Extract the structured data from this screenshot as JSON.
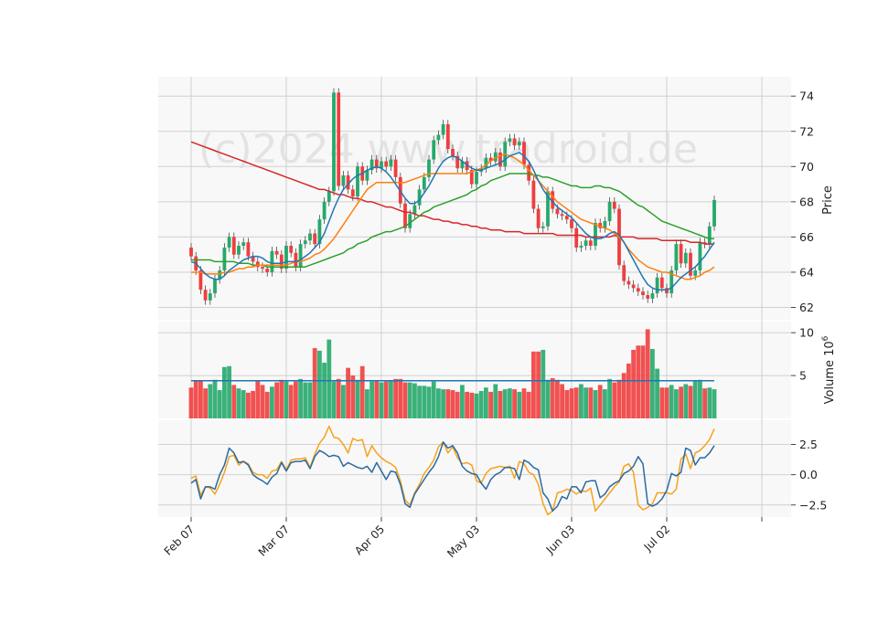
{
  "chart_data": [
    {
      "type": "candlestick",
      "panel": "price",
      "watermark": "(c)2024 www.tradroid.de",
      "ylabel": "Price",
      "ylim": [
        61.3,
        75.1
      ],
      "yticks": [
        62,
        64,
        66,
        68,
        70,
        72,
        74
      ],
      "x_tick_labels": [
        "Feb 07",
        "Mar 07",
        "Apr 05",
        "May 03",
        "Jun 03",
        "Jul 02"
      ],
      "x_tick_index": [
        0,
        20,
        40,
        60,
        80,
        100,
        120
      ],
      "grid": true,
      "colors": {
        "up": "#26a96b",
        "down": "#ef3e3e",
        "ma_fast": "#1f77b4",
        "ma_mid": "#ff7f0e",
        "ma_slow": "#2ca02c",
        "ma_long": "#d62728"
      },
      "closes": [
        64.9,
        64.1,
        63.0,
        62.4,
        62.8,
        63.6,
        64.1,
        65.4,
        66.0,
        65.0,
        65.5,
        65.7,
        64.9,
        64.6,
        64.3,
        64.2,
        64.0,
        65.2,
        65.0,
        64.2,
        65.5,
        65.1,
        64.3,
        65.6,
        65.8,
        66.2,
        65.6,
        67.0,
        68.0,
        68.6,
        74.2,
        68.9,
        69.5,
        68.7,
        68.3,
        70.0,
        69.2,
        69.8,
        70.4,
        69.9,
        70.3,
        70.0,
        70.4,
        69.4,
        67.9,
        66.5,
        67.3,
        67.8,
        68.7,
        69.4,
        70.4,
        71.5,
        71.8,
        72.4,
        71.0,
        70.6,
        69.9,
        70.3,
        69.8,
        69.0,
        69.7,
        69.9,
        70.5,
        70.3,
        70.8,
        70.0,
        71.4,
        71.6,
        71.2,
        71.4,
        70.1,
        69.2,
        67.6,
        66.5,
        66.6,
        68.6,
        67.6,
        67.3,
        67.2,
        67.0,
        66.5,
        65.4,
        65.5,
        65.8,
        65.5,
        66.8,
        66.5,
        66.9,
        68.0,
        67.6,
        64.4,
        63.5,
        63.3,
        63.1,
        62.9,
        62.7,
        62.5,
        62.8,
        63.7,
        63.1,
        62.8,
        64.1,
        65.6,
        64.5,
        65.1,
        63.8,
        64.1,
        65.7,
        65.6,
        66.6,
        68.1
      ],
      "volumes": [
        3.6,
        4.4,
        4.4,
        3.5,
        4.0,
        4.5,
        3.3,
        6.0,
        6.1,
        3.9,
        3.5,
        3.3,
        3.0,
        3.2,
        4.4,
        3.9,
        3.1,
        3.7,
        4.2,
        4.5,
        4.3,
        3.9,
        4.3,
        4.6,
        4.2,
        4.2,
        8.2,
        7.9,
        6.5,
        9.2,
        4.3,
        4.6,
        3.9,
        5.9,
        5.0,
        4.5,
        6.1,
        3.4,
        4.3,
        4.4,
        4.2,
        4.3,
        4.4,
        4.6,
        4.6,
        4.2,
        4.2,
        4.1,
        3.8,
        3.8,
        3.7,
        4.3,
        3.5,
        3.4,
        3.4,
        3.3,
        3.1,
        3.9,
        3.1,
        3.0,
        2.9,
        3.2,
        3.6,
        3.1,
        4.0,
        3.2,
        3.4,
        3.5,
        3.4,
        3.1,
        3.5,
        3.1,
        7.8,
        7.8,
        8.0,
        4.5,
        4.7,
        4.5,
        4.0,
        3.3,
        3.5,
        3.6,
        4.0,
        3.6,
        3.6,
        3.3,
        3.9,
        3.4,
        4.6,
        4.2,
        4.5,
        5.3,
        6.4,
        8.0,
        8.5,
        8.5,
        10.4,
        8.1,
        5.8,
        3.6,
        3.6,
        3.9,
        3.4,
        3.7,
        4.0,
        3.8,
        4.4,
        4.5,
        3.5,
        3.6,
        3.4
      ],
      "ma_fast": [
        64.6,
        64.5,
        64.2,
        63.9,
        63.7,
        63.6,
        63.6,
        63.8,
        64.1,
        64.3,
        64.5,
        64.7,
        64.8,
        64.9,
        64.9,
        64.8,
        64.6,
        64.5,
        64.5,
        64.5,
        64.6,
        64.6,
        64.6,
        64.7,
        64.9,
        65.1,
        65.4,
        65.7,
        66.2,
        66.9,
        67.6,
        68.2,
        68.7,
        69.0,
        69.3,
        69.5,
        69.6,
        69.8,
        69.9,
        70.0,
        69.9,
        69.7,
        69.4,
        69.0,
        68.6,
        68.2,
        67.9,
        67.9,
        68.1,
        68.5,
        68.9,
        69.4,
        69.9,
        70.3,
        70.5,
        70.6,
        70.5,
        70.3,
        70.1,
        69.9,
        69.8,
        69.8,
        69.9,
        70.0,
        70.1,
        70.2,
        70.4,
        70.6,
        70.7,
        70.8,
        70.6,
        70.3,
        69.8,
        69.2,
        68.7,
        68.3,
        68.0,
        67.7,
        67.5,
        67.3,
        67.1,
        66.8,
        66.5,
        66.2,
        66.0,
        65.9,
        65.9,
        66.0,
        66.2,
        66.3,
        66.1,
        65.7,
        65.2,
        64.7,
        64.2,
        63.7,
        63.3,
        63.1,
        63.0,
        63.0,
        63.0,
        63.1,
        63.4,
        63.7,
        63.9,
        64.1,
        64.3,
        64.6,
        64.9,
        65.3,
        65.7
      ],
      "ma_mid": [
        64.0,
        64.0,
        64.0,
        63.9,
        63.9,
        63.9,
        63.9,
        64.0,
        64.0,
        64.1,
        64.2,
        64.2,
        64.3,
        64.3,
        64.4,
        64.4,
        64.4,
        64.4,
        64.4,
        64.4,
        64.4,
        64.5,
        64.6,
        64.6,
        64.7,
        64.8,
        65.0,
        65.1,
        65.3,
        65.6,
        65.9,
        66.3,
        66.7,
        67.1,
        67.5,
        67.9,
        68.3,
        68.7,
        68.9,
        69.1,
        69.1,
        69.1,
        69.1,
        69.1,
        69.1,
        69.1,
        69.2,
        69.3,
        69.4,
        69.5,
        69.6,
        69.6,
        69.6,
        69.6,
        69.6,
        69.6,
        69.6,
        69.6,
        69.6,
        69.7,
        69.8,
        69.9,
        70.1,
        70.3,
        70.5,
        70.6,
        70.7,
        70.6,
        70.5,
        70.3,
        70.1,
        69.8,
        69.5,
        69.2,
        68.9,
        68.6,
        68.3,
        68.0,
        67.8,
        67.6,
        67.4,
        67.2,
        67.0,
        66.9,
        66.8,
        66.7,
        66.6,
        66.5,
        66.4,
        66.2,
        66.0,
        65.7,
        65.3,
        65.0,
        64.7,
        64.5,
        64.3,
        64.2,
        64.1,
        64.0,
        64.0,
        63.9,
        63.8,
        63.7,
        63.6,
        63.6,
        63.7,
        63.8,
        64.0,
        64.1,
        64.3
      ],
      "ma_slow": [
        64.7,
        64.7,
        64.7,
        64.7,
        64.7,
        64.6,
        64.6,
        64.6,
        64.6,
        64.6,
        64.5,
        64.5,
        64.5,
        64.4,
        64.4,
        64.4,
        64.3,
        64.3,
        64.3,
        64.3,
        64.3,
        64.3,
        64.3,
        64.3,
        64.3,
        64.4,
        64.5,
        64.6,
        64.7,
        64.8,
        64.9,
        65.0,
        65.1,
        65.3,
        65.4,
        65.6,
        65.7,
        65.8,
        66.0,
        66.1,
        66.2,
        66.3,
        66.3,
        66.4,
        66.5,
        66.6,
        66.8,
        67.0,
        67.2,
        67.4,
        67.5,
        67.7,
        67.8,
        67.9,
        68.0,
        68.1,
        68.2,
        68.3,
        68.4,
        68.6,
        68.7,
        68.9,
        69.0,
        69.2,
        69.3,
        69.4,
        69.5,
        69.6,
        69.6,
        69.6,
        69.6,
        69.6,
        69.5,
        69.5,
        69.4,
        69.4,
        69.3,
        69.2,
        69.1,
        69.0,
        68.9,
        68.9,
        68.8,
        68.8,
        68.8,
        68.9,
        68.9,
        68.8,
        68.8,
        68.7,
        68.6,
        68.4,
        68.2,
        68.0,
        67.8,
        67.7,
        67.5,
        67.3,
        67.1,
        66.9,
        66.8,
        66.7,
        66.6,
        66.5,
        66.4,
        66.3,
        66.2,
        66.1,
        66.0,
        65.9,
        65.9
      ],
      "ma_long": [
        71.4,
        71.3,
        71.2,
        71.1,
        71.0,
        70.9,
        70.8,
        70.7,
        70.6,
        70.5,
        70.4,
        70.3,
        70.2,
        70.1,
        70.0,
        69.9,
        69.8,
        69.7,
        69.6,
        69.5,
        69.4,
        69.3,
        69.2,
        69.1,
        69.0,
        68.9,
        68.8,
        68.7,
        68.7,
        68.6,
        68.5,
        68.4,
        68.4,
        68.3,
        68.2,
        68.2,
        68.1,
        68.0,
        68.0,
        67.9,
        67.8,
        67.7,
        67.7,
        67.6,
        67.5,
        67.4,
        67.4,
        67.3,
        67.2,
        67.2,
        67.1,
        67.0,
        67.0,
        66.9,
        66.9,
        66.8,
        66.8,
        66.7,
        66.7,
        66.6,
        66.6,
        66.5,
        66.5,
        66.4,
        66.4,
        66.4,
        66.3,
        66.3,
        66.3,
        66.3,
        66.2,
        66.2,
        66.2,
        66.2,
        66.2,
        66.2,
        66.2,
        66.1,
        66.1,
        66.1,
        66.1,
        66.1,
        66.1,
        66.0,
        66.0,
        66.0,
        66.0,
        66.0,
        66.0,
        66.1,
        66.0,
        66.0,
        66.0,
        66.0,
        65.9,
        65.9,
        65.9,
        65.9,
        65.9,
        65.8,
        65.8,
        65.8,
        65.8,
        65.8,
        65.8,
        65.7,
        65.7,
        65.7,
        65.6,
        65.6,
        65.6
      ]
    },
    {
      "type": "bar",
      "panel": "volume",
      "ylabel": "Volume  10^6",
      "ylim": [
        0,
        11.3
      ],
      "yticks": [
        5,
        10
      ],
      "volume_ma": 4.4
    },
    {
      "type": "line",
      "panel": "oscillator",
      "ylim": [
        -3.5,
        4.5
      ],
      "yticks": [
        -2.5,
        0.0,
        2.5
      ],
      "ytick_labels": [
        "−2.5",
        "0.0",
        "2.5"
      ],
      "colors": {
        "main": "#2b6aa0",
        "signal": "#f7a21b"
      },
      "main": [
        -0.7,
        -0.4,
        -2.0,
        -1.0,
        -1.0,
        -1.2,
        0.0,
        0.8,
        2.2,
        1.8,
        1.0,
        1.1,
        0.8,
        0.0,
        -0.3,
        -0.5,
        -0.8,
        -0.2,
        0.1,
        1.0,
        0.3,
        1.0,
        1.1,
        1.1,
        1.2,
        0.5,
        1.5,
        2.0,
        1.8,
        1.5,
        1.6,
        1.5,
        0.7,
        1.0,
        0.8,
        0.6,
        0.5,
        0.7,
        0.2,
        1.0,
        0.3,
        -0.4,
        0.3,
        0.2,
        -0.8,
        -2.4,
        -2.7,
        -1.6,
        -1.0,
        -0.4,
        0.2,
        0.7,
        1.5,
        2.7,
        2.2,
        2.4,
        1.8,
        0.7,
        0.3,
        0.1,
        0.0,
        -0.7,
        -1.2,
        -0.4,
        0.0,
        0.2,
        0.6,
        0.6,
        0.5,
        -0.4,
        1.2,
        1.0,
        0.6,
        0.4,
        -1.5,
        -2.0,
        -3.0,
        -2.6,
        -1.8,
        -2.0,
        -1.0,
        -1.0,
        -1.5,
        -0.6,
        -0.5,
        -0.5,
        -1.9,
        -1.6,
        -1.0,
        -0.7,
        -0.5,
        0.1,
        0.3,
        0.7,
        1.5,
        0.9,
        -2.4,
        -2.6,
        -2.4,
        -2.0,
        -1.3,
        0.1,
        -0.1,
        0.2,
        2.2,
        2.0,
        0.8,
        1.4,
        1.4,
        1.8,
        2.4
      ],
      "signal": [
        -0.3,
        -0.1,
        -1.7,
        -1.0,
        -1.1,
        -1.6,
        -0.8,
        0.2,
        1.5,
        1.6,
        0.8,
        1.1,
        0.9,
        0.2,
        0.0,
        0.0,
        -0.3,
        0.3,
        0.4,
        1.1,
        0.4,
        1.2,
        1.3,
        1.3,
        1.4,
        0.6,
        1.7,
        2.6,
        3.1,
        4.0,
        3.1,
        3.0,
        2.5,
        1.8,
        3.0,
        2.8,
        2.9,
        1.5,
        2.4,
        1.8,
        1.4,
        1.1,
        0.9,
        0.6,
        -0.5,
        -2.1,
        -2.5,
        -1.5,
        -0.8,
        0.1,
        0.6,
        1.2,
        2.3,
        2.7,
        1.8,
        2.3,
        1.4,
        0.9,
        1.0,
        0.8,
        -0.5,
        -0.7,
        0.1,
        0.5,
        0.6,
        0.7,
        0.6,
        0.7,
        -0.3,
        1.1,
        0.9,
        0.2,
        0.0,
        -0.8,
        -2.4,
        -3.3,
        -3.0,
        -1.5,
        -1.4,
        -1.2,
        -1.3,
        -1.6,
        -1.3,
        -1.4,
        -1.1,
        -3.0,
        -2.5,
        -2.0,
        -1.5,
        -1.0,
        -0.6,
        0.7,
        0.9,
        0.2,
        -2.5,
        -2.9,
        -2.7,
        -2.4,
        -1.5,
        -1.5,
        -1.5,
        -1.6,
        -1.2,
        1.3,
        1.7,
        0.5,
        1.8,
        2.0,
        2.4,
        2.9,
        3.8
      ]
    }
  ]
}
